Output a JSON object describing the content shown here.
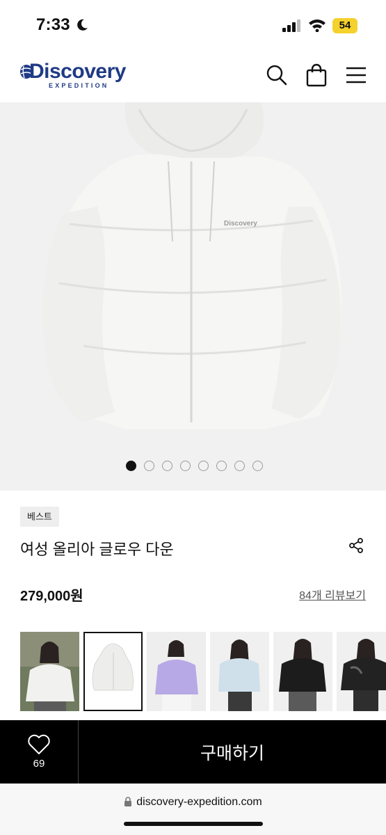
{
  "status_bar": {
    "time": "7:33",
    "battery": "54"
  },
  "header": {
    "brand": "Discovery",
    "brand_sub": "EXPEDITION",
    "icons": {
      "search": "search-icon",
      "bag": "shopping-bag-icon",
      "menu": "hamburger-menu-icon"
    }
  },
  "gallery": {
    "total_images": 8,
    "active_index": 1
  },
  "product": {
    "badge": "베스트",
    "title": "여성 올리아 글로우 다운",
    "price": "279,000원",
    "reviews_link": "84개 리뷰보기",
    "jacket_logo": "Discovery"
  },
  "thumbnails": [
    {
      "color": "ivory-model",
      "selected": false
    },
    {
      "color": "ivory",
      "selected": true
    },
    {
      "color": "lavender",
      "selected": false
    },
    {
      "color": "light-blue",
      "selected": false
    },
    {
      "color": "black",
      "selected": false
    },
    {
      "color": "black-gloss",
      "selected": false
    }
  ],
  "buy_bar": {
    "wish_count": "69",
    "buy_label": "구매하기"
  },
  "browser": {
    "url": "discovery-expedition.com"
  },
  "colors": {
    "brand": "#1f3b86",
    "bar": "#000000",
    "battery": "#f4d12c"
  }
}
